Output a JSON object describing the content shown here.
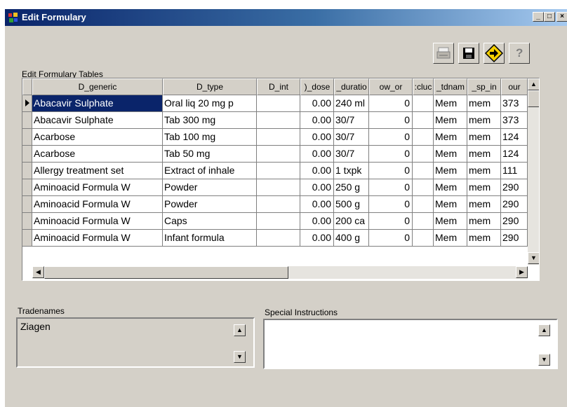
{
  "window": {
    "title": "Edit Formulary"
  },
  "toolbar": {
    "print_icon": "printer-icon",
    "save_icon": "floppy-disk-icon",
    "exit_icon": "exit-arrow-icon",
    "help_label": "?"
  },
  "section_label": "Edit Formulary Tables",
  "grid": {
    "columns": [
      "D_generic",
      "D_type",
      "D_int",
      ")_dose",
      "_duratio",
      "ow_or",
      ":cluc",
      "_tdnam",
      "_sp_in",
      "our"
    ],
    "rows": [
      [
        "Abacavir Sulphate",
        "Oral liq 20 mg p",
        "",
        "0.00",
        "240 ml",
        "0",
        "",
        "Mem",
        "mem",
        "373"
      ],
      [
        "Abacavir Sulphate",
        "Tab 300 mg",
        "",
        "0.00",
        "30/7",
        "0",
        "",
        "Mem",
        "mem",
        "373"
      ],
      [
        "Acarbose",
        "Tab 100 mg",
        "",
        "0.00",
        "30/7",
        "0",
        "",
        "Mem",
        "mem",
        "124"
      ],
      [
        "Acarbose",
        "Tab 50 mg",
        "",
        "0.00",
        "30/7",
        "0",
        "",
        "Mem",
        "mem",
        "124"
      ],
      [
        "Allergy treatment set",
        "Extract of inhale",
        "",
        "0.00",
        "1 txpk",
        "0",
        "",
        "Mem",
        "mem",
        "111"
      ],
      [
        "Aminoacid Formula W",
        "Powder",
        "",
        "0.00",
        "250 g",
        "0",
        "",
        "Mem",
        "mem",
        "290"
      ],
      [
        "Aminoacid Formula W",
        "Powder",
        "",
        "0.00",
        "500 g",
        "0",
        "",
        "Mem",
        "mem",
        "290"
      ],
      [
        "Aminoacid Formula W",
        "Caps",
        "",
        "0.00",
        "200 ca",
        "0",
        "",
        "Mem",
        "mem",
        "290"
      ],
      [
        "Aminoacid Formula W",
        "Infant formula",
        "",
        "0.00",
        "400 g",
        "0",
        "",
        "Mem",
        "mem",
        "290"
      ]
    ],
    "selected_row": 0
  },
  "tradenames": {
    "label": "Tradenames",
    "value": "Ziagen"
  },
  "special_instructions": {
    "label": "Special Instructions",
    "value": ""
  }
}
